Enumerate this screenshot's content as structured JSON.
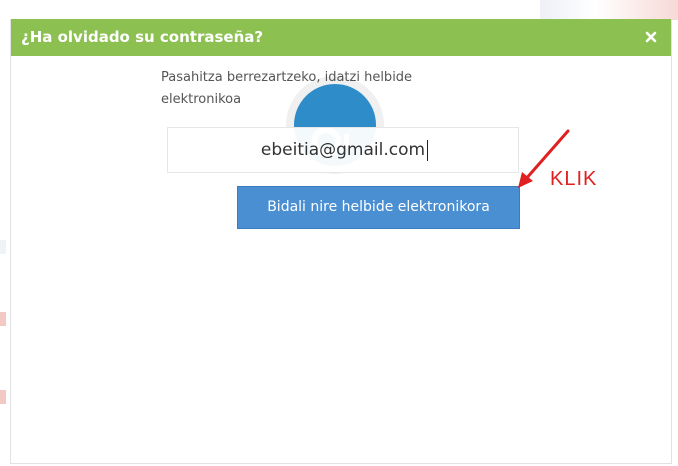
{
  "dialog": {
    "title": "¿Ha olvidado su contraseña?",
    "close_icon": "close-icon"
  },
  "form": {
    "instruction": "Pasahitza berrezartzeko, idatzi helbide elektronikoa",
    "email_value": "ebeitia@gmail.com",
    "submit_label": "Bidali nire helbide elektronikora"
  },
  "annotation": {
    "label": "KLIK",
    "arrow_icon": "red-arrow-icon"
  },
  "colors": {
    "header": "#8cc152",
    "button": "#4a8fd1",
    "annotation": "#e02020"
  }
}
